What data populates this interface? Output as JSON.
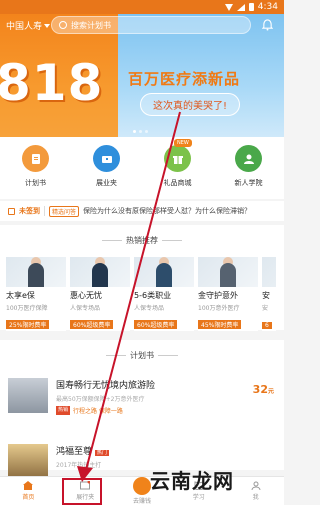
{
  "status": {
    "time": "4:34"
  },
  "header": {
    "city": "中国人寿",
    "search_placeholder": "搜索计划书"
  },
  "banner": {
    "big_text": "818",
    "title": "百万医疗添新品",
    "subtitle": "这次真的美哭了!"
  },
  "quick_menu": [
    {
      "label": "计划书",
      "icon": "plan-icon",
      "color": "#f39a3c"
    },
    {
      "label": "展业夹",
      "icon": "folder-icon",
      "color": "#2f8fdc"
    },
    {
      "label": "礼品商城",
      "icon": "gift-icon",
      "color": "#7cc24a",
      "badge": "NEW"
    },
    {
      "label": "新人学院",
      "icon": "graduate-icon",
      "color": "#4aa84a"
    }
  ],
  "notice": {
    "unsigned": "未签到",
    "topic": "精选问答",
    "text": "保险为什么没有原保险那样受人怼？为什么保险滞销？"
  },
  "hot": {
    "title": "热销推荐",
    "cards": [
      {
        "title": "太享e保",
        "sub": "100万医疗保障",
        "tag": "25%限时费率"
      },
      {
        "title": "惠心无忧",
        "sub": "人保专场品",
        "tag": "60%超级费率"
      },
      {
        "title": "5-6类职业",
        "sub": "人保专场品",
        "tag": "60%超级费率"
      },
      {
        "title": "金守护意外",
        "sub": "100万意外医疗",
        "tag": "45%限时费率"
      },
      {
        "title": "安",
        "sub": "安",
        "tag": "6"
      }
    ]
  },
  "plans": {
    "title": "计划书",
    "items": [
      {
        "title": "国寿畅行无忧境内旅游险",
        "sub": "最高50万保额保障+2万意外医疗",
        "hot": "热销",
        "line": "行程之路 保障一路",
        "price": "32",
        "unit": "元"
      },
      {
        "title": "鸿福至尊",
        "hot": "热门",
        "sub": "2017年热销主打"
      }
    ]
  },
  "bottom_nav": [
    {
      "label": "首页",
      "icon": "home-icon",
      "active": true
    },
    {
      "label": "展行夹",
      "icon": "message-icon",
      "active": false
    },
    {
      "label": "去赚钱",
      "icon": "money-icon",
      "active": false
    },
    {
      "label": "学习",
      "icon": "study-icon",
      "active": false
    },
    {
      "label": "我",
      "icon": "user-icon",
      "active": false
    }
  ],
  "watermark": "云南龙网",
  "colors": {
    "accent": "#e8761a",
    "highlight_box": "#c7132a"
  }
}
